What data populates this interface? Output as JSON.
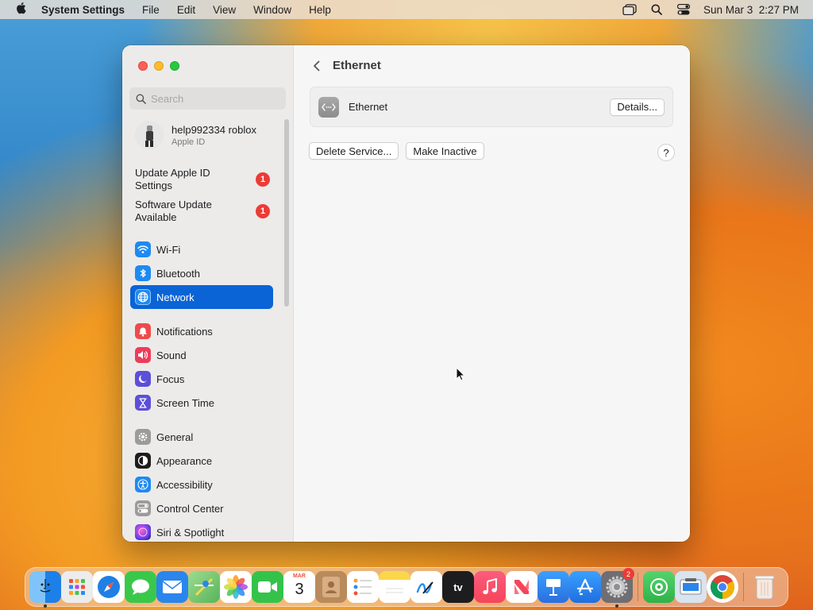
{
  "menubar": {
    "app_name": "System Settings",
    "items": [
      "File",
      "Edit",
      "View",
      "Window",
      "Help"
    ],
    "clock": "Sun Mar 3  2:27 PM"
  },
  "sidebar": {
    "search_placeholder": "Search",
    "account": {
      "name": "help992334 roblox",
      "subtitle": "Apple ID"
    },
    "notices": [
      {
        "label": "Update Apple ID Settings",
        "badge": "1"
      },
      {
        "label": "Software Update Available",
        "badge": "1"
      }
    ],
    "group1": [
      {
        "label": "Wi-Fi",
        "icon": "wifi-icon",
        "color": "#1e8af2"
      },
      {
        "label": "Bluetooth",
        "icon": "bluetooth-icon",
        "color": "#1e8af2"
      },
      {
        "label": "Network",
        "icon": "globe-icon",
        "color": "#1e8af2",
        "selected": true
      }
    ],
    "group2": [
      {
        "label": "Notifications",
        "icon": "bell-icon",
        "color": "#ee4b4b"
      },
      {
        "label": "Sound",
        "icon": "speaker-icon",
        "color": "#ee3c5a"
      },
      {
        "label": "Focus",
        "icon": "moon-icon",
        "color": "#5c4fd8"
      },
      {
        "label": "Screen Time",
        "icon": "hourglass-icon",
        "color": "#5c4fd8"
      }
    ],
    "group3": [
      {
        "label": "General",
        "icon": "gear-icon",
        "color": "#9b9b9b"
      },
      {
        "label": "Appearance",
        "icon": "appearance-icon",
        "color": "#1d1d1f"
      },
      {
        "label": "Accessibility",
        "icon": "accessibility-icon",
        "color": "#1e8af2"
      },
      {
        "label": "Control Center",
        "icon": "control-center-icon",
        "color": "#9b9b9b"
      },
      {
        "label": "Siri & Spotlight",
        "icon": "siri-icon",
        "color": "#b03cd8"
      }
    ]
  },
  "main": {
    "title": "Ethernet",
    "service_label": "Ethernet",
    "details_label": "Details...",
    "delete_label": "Delete Service...",
    "inactive_label": "Make Inactive",
    "help_label": "?"
  },
  "dock": {
    "calendar_month": "MAR",
    "calendar_day": "3",
    "settings_badge": "2",
    "apps": [
      {
        "name": "finder",
        "color": "#2e8ff0"
      },
      {
        "name": "launchpad",
        "color": "#e8e8e8"
      },
      {
        "name": "safari",
        "color": "#1e7fe6"
      },
      {
        "name": "messages",
        "color": "#3ac84a"
      },
      {
        "name": "mail",
        "color": "#2a86ec"
      },
      {
        "name": "maps",
        "color": "#56b45a"
      },
      {
        "name": "photos",
        "color": "#ffffff"
      },
      {
        "name": "facetime",
        "color": "#34c34a"
      },
      {
        "name": "calendar",
        "color": "#ffffff"
      },
      {
        "name": "contacts",
        "color": "#b98a5b"
      },
      {
        "name": "reminders",
        "color": "#ffffff"
      },
      {
        "name": "notes",
        "color": "#fbd64b"
      },
      {
        "name": "freeform",
        "color": "#ffffff"
      },
      {
        "name": "apple-tv",
        "color": "#1d1d1f"
      },
      {
        "name": "music",
        "color": "#f5455a"
      },
      {
        "name": "news",
        "color": "#ffffff"
      },
      {
        "name": "keynote",
        "color": "#2a8ff1"
      },
      {
        "name": "app-store",
        "color": "#1e8af2"
      },
      {
        "name": "system-settings",
        "color": "#8e8e93"
      }
    ],
    "extra_apps": [
      {
        "name": "find-my",
        "color": "#3fbf55"
      },
      {
        "name": "preview",
        "color": "#d8e4f0"
      },
      {
        "name": "chrome",
        "color": "#ffffff"
      }
    ]
  }
}
